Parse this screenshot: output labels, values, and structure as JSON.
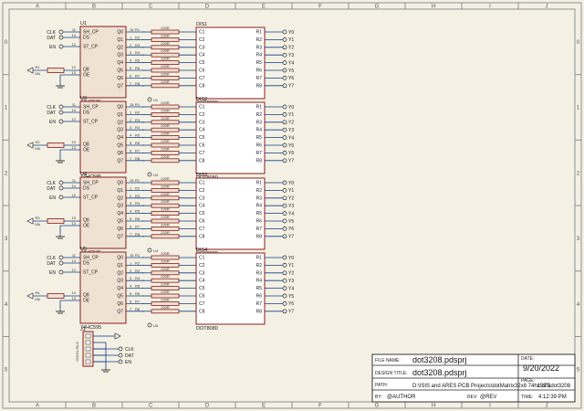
{
  "colors": {
    "paper": "#f4f1e4",
    "wire": "#0b3d8c",
    "chip_fill": "#efe2d2",
    "chip_stroke": "#8a1a1a",
    "border": "#8b8f96"
  },
  "border": {
    "cols": [
      "A",
      "B",
      "C",
      "D",
      "E",
      "F",
      "G",
      "H",
      "I",
      "J"
    ],
    "rows": [
      "0",
      "1",
      "2",
      "3",
      "4",
      "5"
    ]
  },
  "modules": [
    {
      "ic": "U1",
      "ic_part": "74HC595",
      "disp": "DIS1",
      "disp_part": "DOT8080",
      "r_ser": "R1",
      "r_ser_val": "10k",
      "r_pins": [
        "R1",
        "R2",
        "R3",
        "R4",
        "R5",
        "R6",
        "R7",
        "R8"
      ],
      "gnd_label": "U1",
      "en_label": "OE"
    },
    {
      "ic": "U3",
      "ic_part": "74HC595",
      "disp": "DIS2",
      "disp_part": "DOT8080",
      "r_ser": "R2",
      "r_ser_val": "10k",
      "r_pins": [
        "R1",
        "R2",
        "R3",
        "R4",
        "R5",
        "R6",
        "R7",
        "R8"
      ],
      "gnd_label": "U3",
      "en_label": "OE"
    },
    {
      "ic": "U4",
      "ic_part": "74HC595",
      "disp": "DIS3",
      "disp_part": "DOT8080",
      "r_ser": "R3",
      "r_ser_val": "10k",
      "r_pins": [
        "R1",
        "R2",
        "R3",
        "R4",
        "R5",
        "R6",
        "R7",
        "R8"
      ],
      "gnd_label": "U4",
      "en_label": "OE"
    },
    {
      "ic": "U5",
      "ic_part": "74HC595",
      "disp": "DIS4",
      "disp_part": "DOT8080",
      "r_ser": "R4",
      "r_ser_val": "10k",
      "r_pins": [
        "R1",
        "R2",
        "R3",
        "R4",
        "R5",
        "R6",
        "R7",
        "R8"
      ],
      "gnd_label": "U5",
      "en_label": "OE"
    }
  ],
  "ic_left_pins": [
    "SH_CP",
    "DS",
    "ST_CP",
    "Q8",
    "OE"
  ],
  "ic_left_nums": [
    "11",
    "14",
    "12",
    "10",
    "13"
  ],
  "ic_right_pins": [
    "Q0",
    "Q1",
    "Q2",
    "Q3",
    "Q4",
    "Q5",
    "Q6",
    "Q7"
  ],
  "ic_right_nums": [
    "15",
    "1",
    "2",
    "3",
    "4",
    "5",
    "6",
    "7"
  ],
  "net_inputs": [
    "CLK",
    "DAT",
    "EN"
  ],
  "resistor_value": "220R",
  "disp_left_pins": [
    "C1",
    "C2",
    "C3",
    "C4",
    "C5",
    "C6",
    "C7",
    "C8"
  ],
  "disp_right_pins": [
    "R1",
    "R2",
    "R3",
    "R4",
    "R5",
    "R6",
    "R7",
    "R8"
  ],
  "disp_outputs": [
    "Y0",
    "Y1",
    "Y2",
    "Y3",
    "Y4",
    "Y5",
    "Y6",
    "Y7"
  ],
  "connector": {
    "ref": "J1",
    "part": "CONN-SIL5",
    "nets": [
      "CLK",
      "DAT",
      "EN"
    ]
  },
  "title_block": {
    "file_name_key": "FILE NAME:",
    "file_name": "dot3208.pdsprj",
    "date_key": "DATE:",
    "date": "9/20/2022",
    "design_title_key": "DESIGN TITLE:",
    "design_title": "dot3208.pdsprj",
    "page_key": "PAGE:",
    "page": "1 of 1",
    "path_key": "PATH:",
    "path": "D:\\ISIS and ARES PCB Projects\\dotMatrix32x8 74hc595\\dot3208",
    "by_key": "BY:",
    "by": "@AUTHOR",
    "rev_key": "REV:",
    "rev": "@REV",
    "time_key": "TIME:",
    "time": "4:12:39 PM"
  }
}
